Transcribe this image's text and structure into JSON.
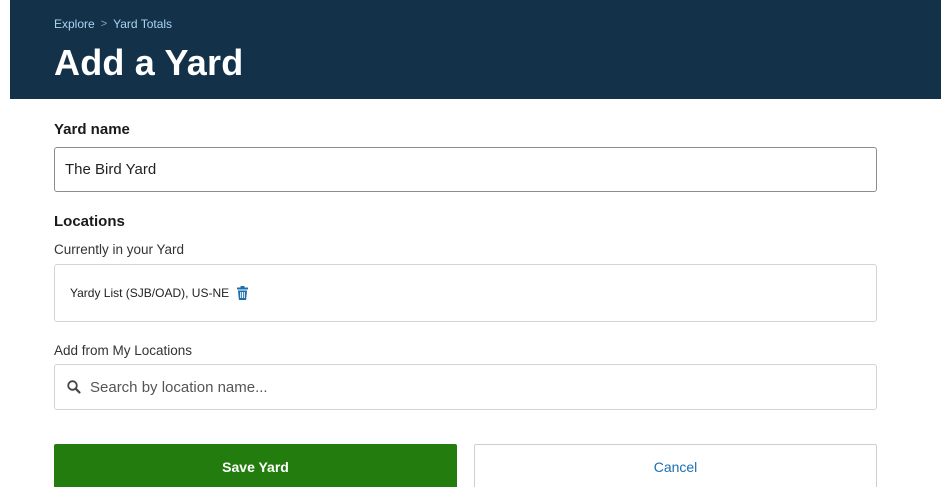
{
  "header": {
    "breadcrumb": [
      "Explore",
      "Yard Totals"
    ],
    "breadcrumb_separator": ">",
    "title": "Add a Yard"
  },
  "form": {
    "yard_name_label": "Yard name",
    "yard_name_value": "The Bird Yard",
    "locations_label": "Locations",
    "current_label": "Currently in your Yard",
    "current_locations": [
      {
        "name": "Yardy List (SJB/OAD), US-NE",
        "icon": "trash-icon"
      }
    ],
    "add_label": "Add from My Locations",
    "search_placeholder": "Search by location name...",
    "search_value": ""
  },
  "actions": {
    "save_label": "Save Yard",
    "cancel_label": "Cancel"
  },
  "colors": {
    "header_bg": "#13324a",
    "breadcrumb_link": "#a9d4f0",
    "save_bg": "#237d0e",
    "cancel_text": "#1c6fae",
    "trash_icon": "#1c6fae"
  }
}
